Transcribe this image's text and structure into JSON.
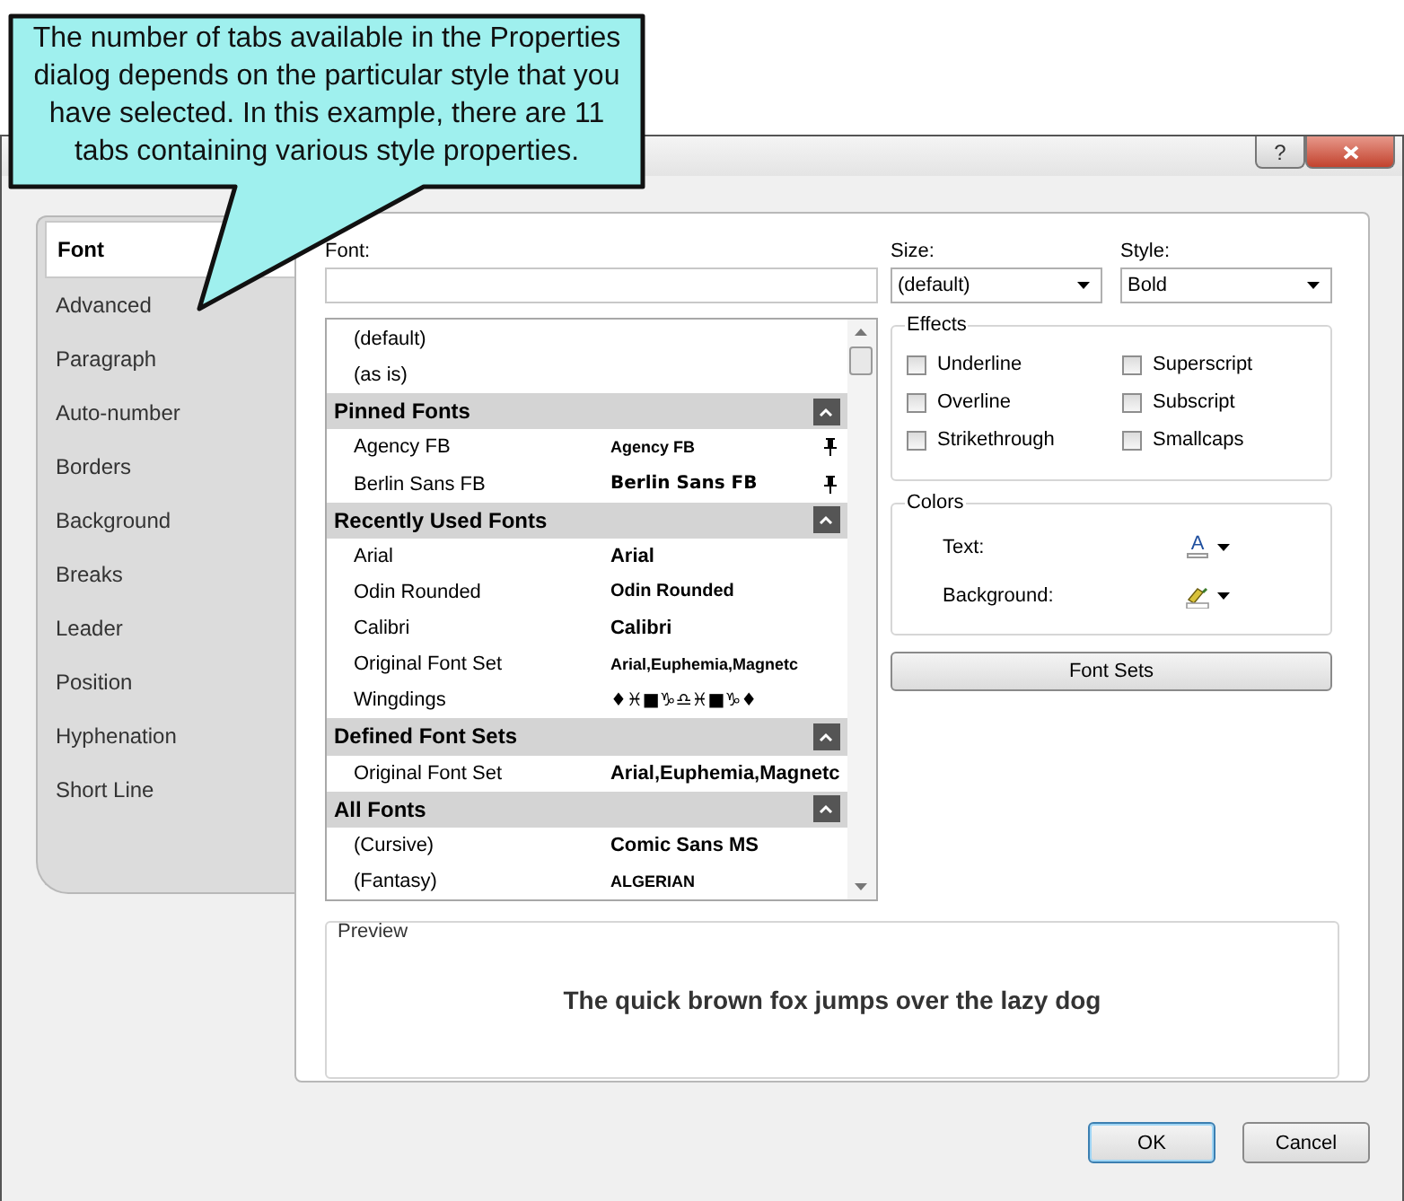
{
  "callout": {
    "text": "The number of tabs available in the Properties dialog depends on the particular style that you have selected. In this example, there are 11 tabs containing various style properties."
  },
  "window": {
    "help_label": "?"
  },
  "tabs": [
    {
      "label": "Font",
      "selected": true
    },
    {
      "label": "Advanced",
      "selected": false
    },
    {
      "label": "Paragraph",
      "selected": false
    },
    {
      "label": "Auto-number",
      "selected": false
    },
    {
      "label": "Borders",
      "selected": false
    },
    {
      "label": "Background",
      "selected": false
    },
    {
      "label": "Breaks",
      "selected": false
    },
    {
      "label": "Leader",
      "selected": false
    },
    {
      "label": "Position",
      "selected": false
    },
    {
      "label": "Hyphenation",
      "selected": false
    },
    {
      "label": "Short Line",
      "selected": false
    }
  ],
  "font_field": {
    "label": "Font:"
  },
  "font_list": [
    {
      "kind": "font",
      "name": "(default)",
      "pinned": false
    },
    {
      "kind": "font",
      "name": "(as is)",
      "pinned": false
    },
    {
      "kind": "header",
      "label": "Pinned Fonts",
      "expanded": true
    },
    {
      "kind": "font",
      "name": "Agency FB",
      "sample": "Agency FB",
      "pinned": true
    },
    {
      "kind": "font",
      "name": "Berlin Sans FB",
      "sample": "Berlin Sans FB",
      "pinned": true
    },
    {
      "kind": "header",
      "label": "Recently Used Fonts",
      "expanded": true
    },
    {
      "kind": "font",
      "name": "Arial",
      "sample": "Arial",
      "pinned": false
    },
    {
      "kind": "font",
      "name": "Odin Rounded",
      "sample": "Odin Rounded",
      "pinned": false
    },
    {
      "kind": "font",
      "name": "Calibri",
      "sample": "Calibri",
      "pinned": false
    },
    {
      "kind": "font",
      "name": "Original Font Set",
      "sample": "Arial,Euphemia,Magnetc",
      "pinned": false
    },
    {
      "kind": "font",
      "name": "Wingdings",
      "sample": "♦♓■♑♎♓■♑♦",
      "pinned": false
    },
    {
      "kind": "header",
      "label": "Defined Font Sets",
      "expanded": true
    },
    {
      "kind": "font",
      "name": "Original Font Set",
      "sample": "Arial,Euphemia,Magnetc",
      "pinned": false
    },
    {
      "kind": "header",
      "label": "All Fonts",
      "expanded": true
    },
    {
      "kind": "font",
      "name": "(Cursive)",
      "sample": "Comic Sans MS",
      "pinned": false
    },
    {
      "kind": "font",
      "name": "(Fantasy)",
      "sample": "ALGERIAN",
      "pinned": false
    }
  ],
  "size": {
    "label": "Size:",
    "value": "(default)"
  },
  "style": {
    "label": "Style:",
    "value": "Bold"
  },
  "effects": {
    "title": "Effects",
    "options": [
      {
        "label": "Underline",
        "checked": false
      },
      {
        "label": "Superscript",
        "checked": false
      },
      {
        "label": "Overline",
        "checked": false
      },
      {
        "label": "Subscript",
        "checked": false
      },
      {
        "label": "Strikethrough",
        "checked": false
      },
      {
        "label": "Smallcaps",
        "checked": false
      }
    ]
  },
  "colors": {
    "title": "Colors",
    "items": [
      {
        "label": "Text:",
        "kind": "text",
        "glyph": "A"
      },
      {
        "label": "Background:",
        "kind": "background"
      }
    ]
  },
  "font_sets_button": "Font Sets",
  "preview": {
    "title": "Preview",
    "text": "The quick brown fox jumps over the lazy dog"
  },
  "buttons": [
    "OK",
    "Cancel"
  ]
}
